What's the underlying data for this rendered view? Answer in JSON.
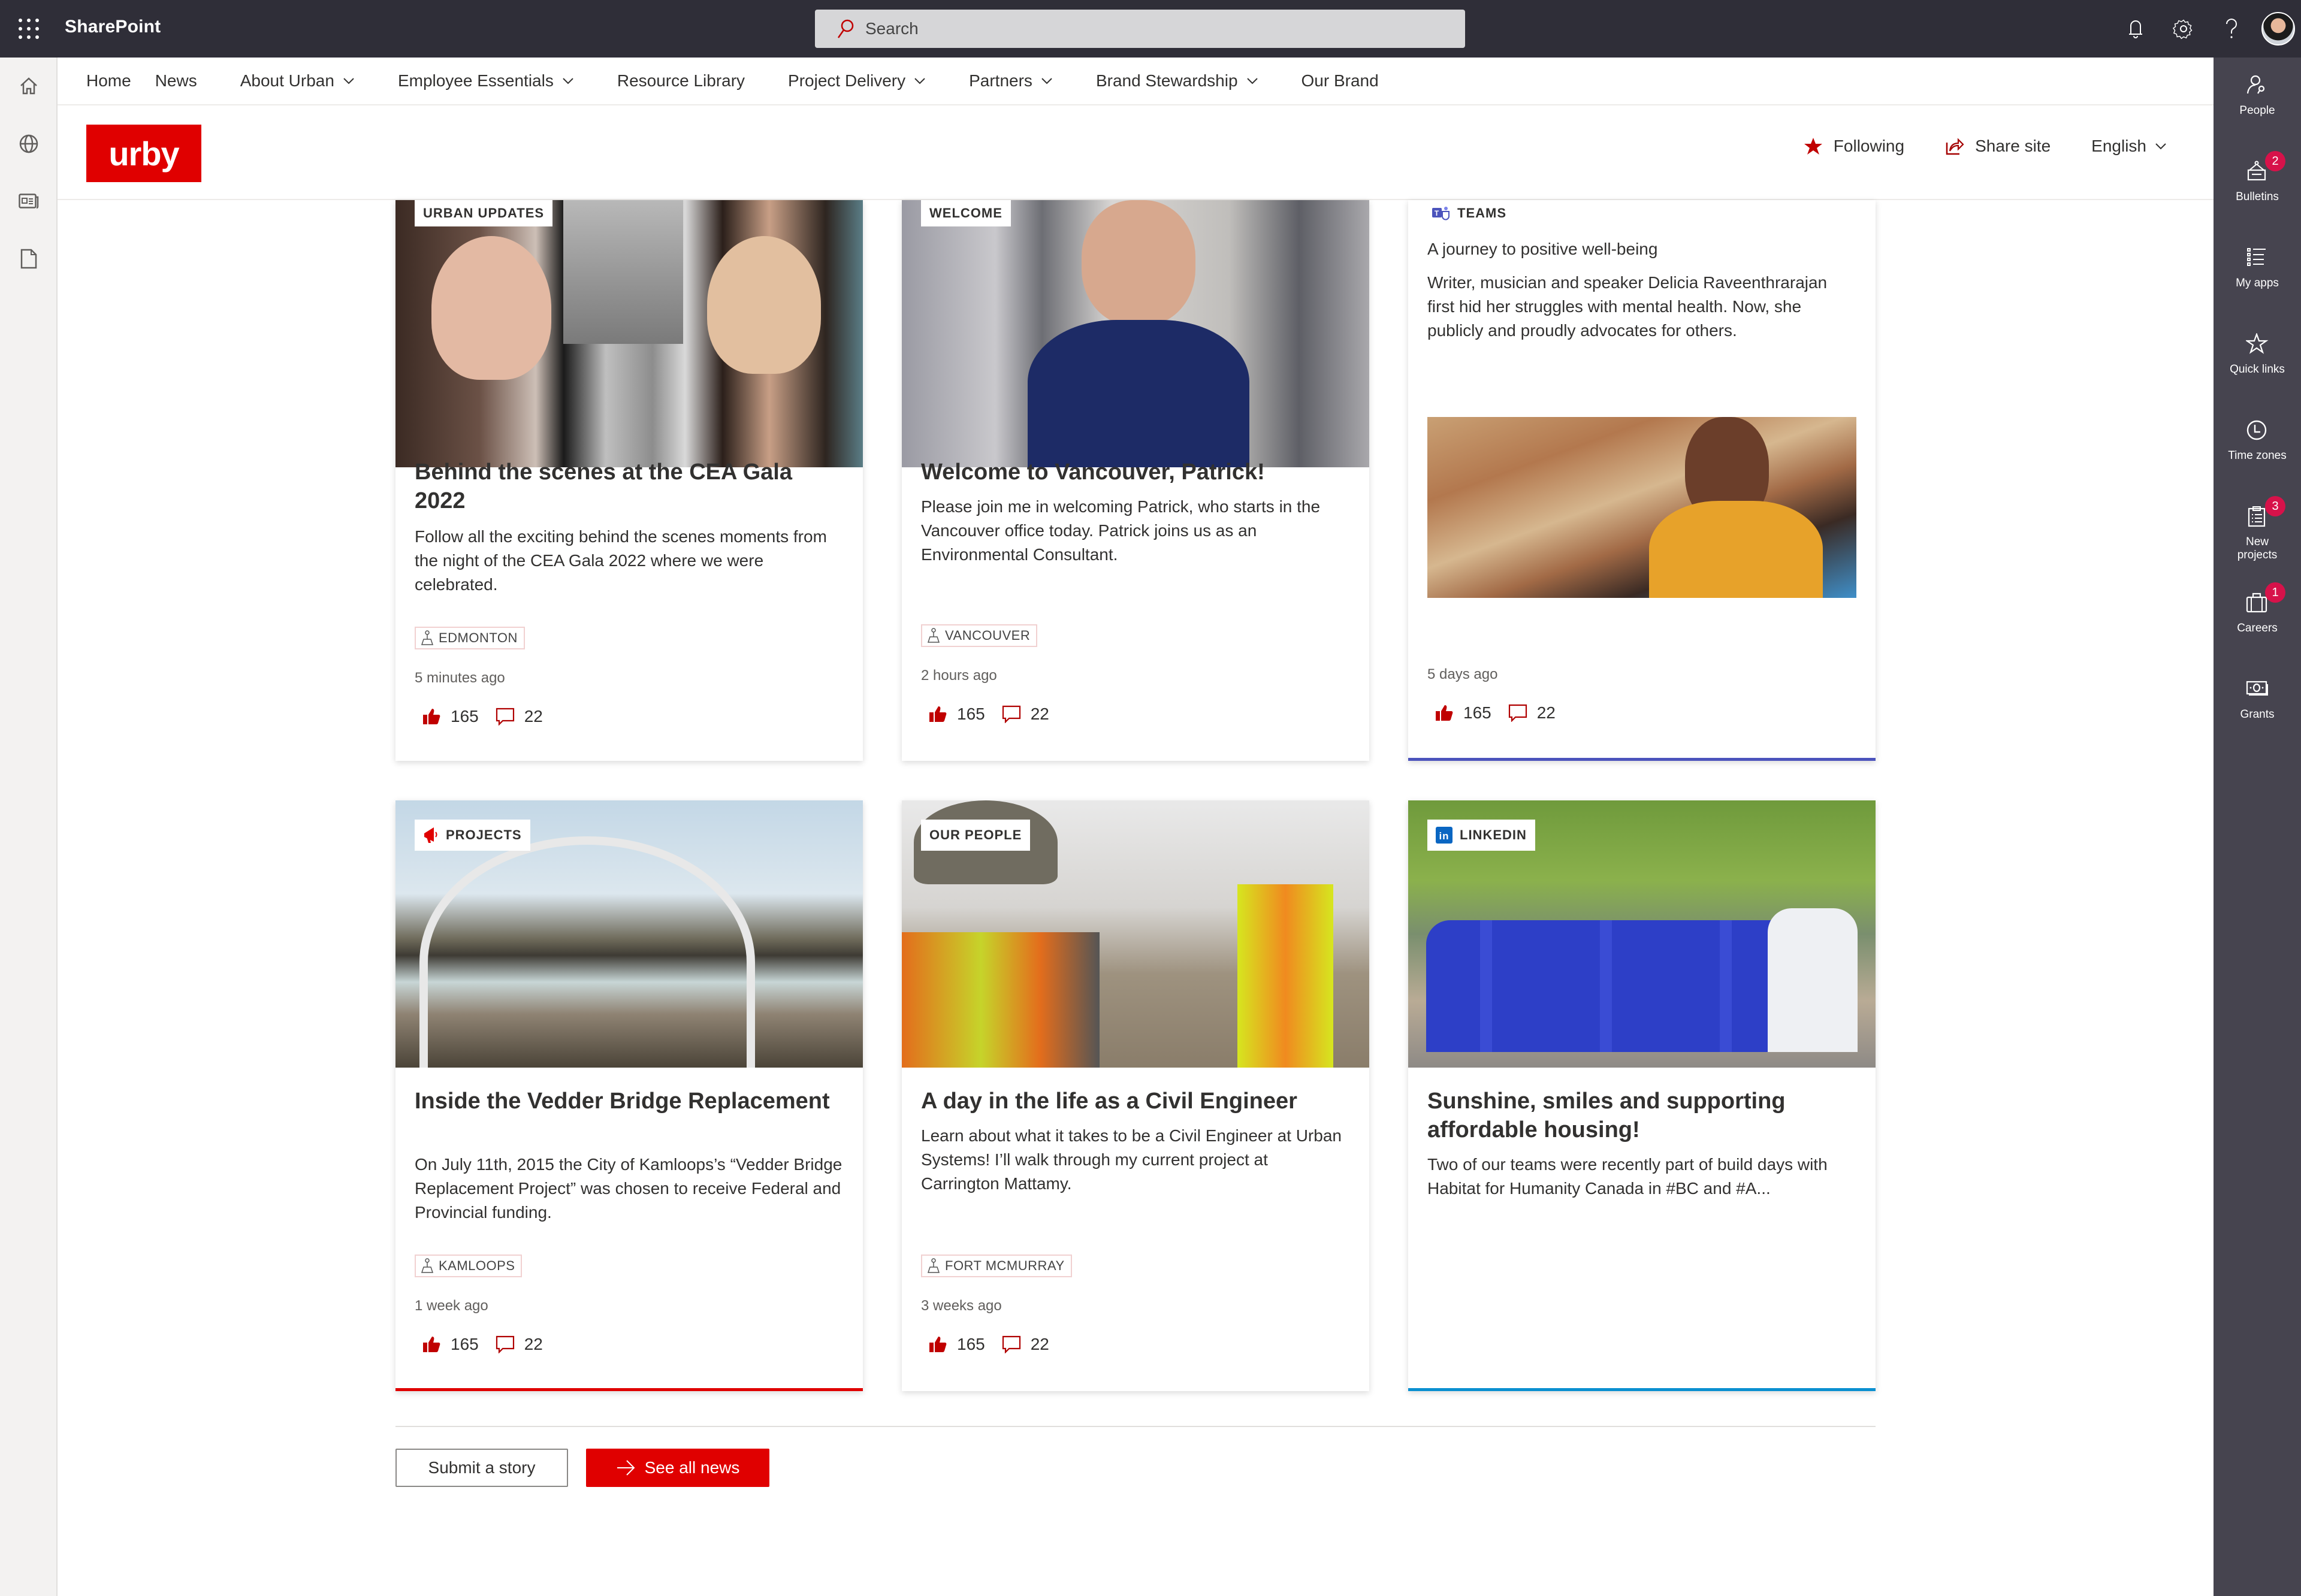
{
  "suitebar": {
    "app_name": "SharePoint",
    "search_placeholder": "Search"
  },
  "hubnav": {
    "items": [
      {
        "label": "Home",
        "has_dropdown": false
      },
      {
        "label": "News",
        "has_dropdown": false
      },
      {
        "label": "About Urban",
        "has_dropdown": true
      },
      {
        "label": "Employee Essentials",
        "has_dropdown": true
      },
      {
        "label": "Resource Library",
        "has_dropdown": false
      },
      {
        "label": "Project Delivery",
        "has_dropdown": true
      },
      {
        "label": "Partners",
        "has_dropdown": true
      },
      {
        "label": "Brand Stewardship",
        "has_dropdown": true
      },
      {
        "label": "Our Brand",
        "has_dropdown": false
      }
    ]
  },
  "site": {
    "logo_text": "urby",
    "following_label": "Following",
    "share_label": "Share site",
    "language": "English"
  },
  "rightbar": {
    "items": [
      {
        "label": "People",
        "icon": "people-search-icon",
        "badge": null
      },
      {
        "label": "Bulletins",
        "icon": "bulletin-board-icon",
        "badge": "2"
      },
      {
        "label": "My apps",
        "icon": "apps-list-icon",
        "badge": null
      },
      {
        "label": "Quick links",
        "icon": "star-icon",
        "badge": null
      },
      {
        "label": "Time zones",
        "icon": "clock-icon",
        "badge": null
      },
      {
        "label": "New projects",
        "icon": "clipboard-icon",
        "badge": "3"
      },
      {
        "label": "Careers",
        "icon": "briefcase-icon",
        "badge": "1"
      },
      {
        "label": "Grants",
        "icon": "money-icon",
        "badge": null
      }
    ]
  },
  "news": {
    "cards": [
      {
        "tag": "URBAN UPDATES",
        "title": "Behind the scenes at the CEA Gala 2022",
        "description": "Follow all the exciting behind the scenes moments from the night of the CEA Gala 2022 where we were celebrated.",
        "location": "EDMONTON",
        "time": "5 minutes ago",
        "likes": "165",
        "comments": "22"
      },
      {
        "tag": "WELCOME",
        "title": "Welcome to Vancouver, Patrick!",
        "description": "Please join me in welcoming Patrick, who starts in the Vancouver office today. Patrick joins us as an Environmental Consultant.",
        "location": "VANCOUVER",
        "time": "2 hours ago",
        "likes": "165",
        "comments": "22"
      },
      {
        "tag": "TEAMS",
        "title": "A journey to positive well-being",
        "description": "Writer, musician and speaker Delicia Raveenthrarajan first hid her struggles with mental health. Now, she publicly and proudly advocates for others.",
        "time": "5 days ago",
        "likes": "165",
        "comments": "22",
        "accent": "#4b53bc"
      },
      {
        "tag": "PROJECTS",
        "title": "Inside the Vedder Bridge Replacement",
        "description": "On July 11th, 2015 the City of Kamloops’s “Vedder Bridge Replacement Project” was chosen to receive Federal and Provincial funding.",
        "location": "KAMLOOPS",
        "time": "1 week ago",
        "likes": "165",
        "comments": "22",
        "accent": "#e00000"
      },
      {
        "tag": "OUR PEOPLE",
        "title": "A day in the life as a Civil Engineer",
        "description": "Learn about what it takes to be a Civil Engineer at Urban Systems! I’ll walk through my current project at Carrington Mattamy.",
        "location": "FORT MCMURRAY",
        "time": "3 weeks ago",
        "likes": "165",
        "comments": "22"
      },
      {
        "tag": "LINKEDIN",
        "title": "Sunshine, smiles and supporting affordable housing!",
        "description": "Two of our teams were recently part of build days with Habitat for Humanity Canada in #BC and #A...",
        "accent": "#0a8fd0"
      }
    ]
  },
  "actions": {
    "submit_label": "Submit a story",
    "see_all_label": "See all news"
  },
  "colors": {
    "brand_red": "#e00000",
    "suitebar": "#2f2e38",
    "rightbar": "#46444f",
    "badge": "#d7124a",
    "teams_accent": "#4b53bc",
    "linkedin_accent": "#0a8fd0"
  }
}
